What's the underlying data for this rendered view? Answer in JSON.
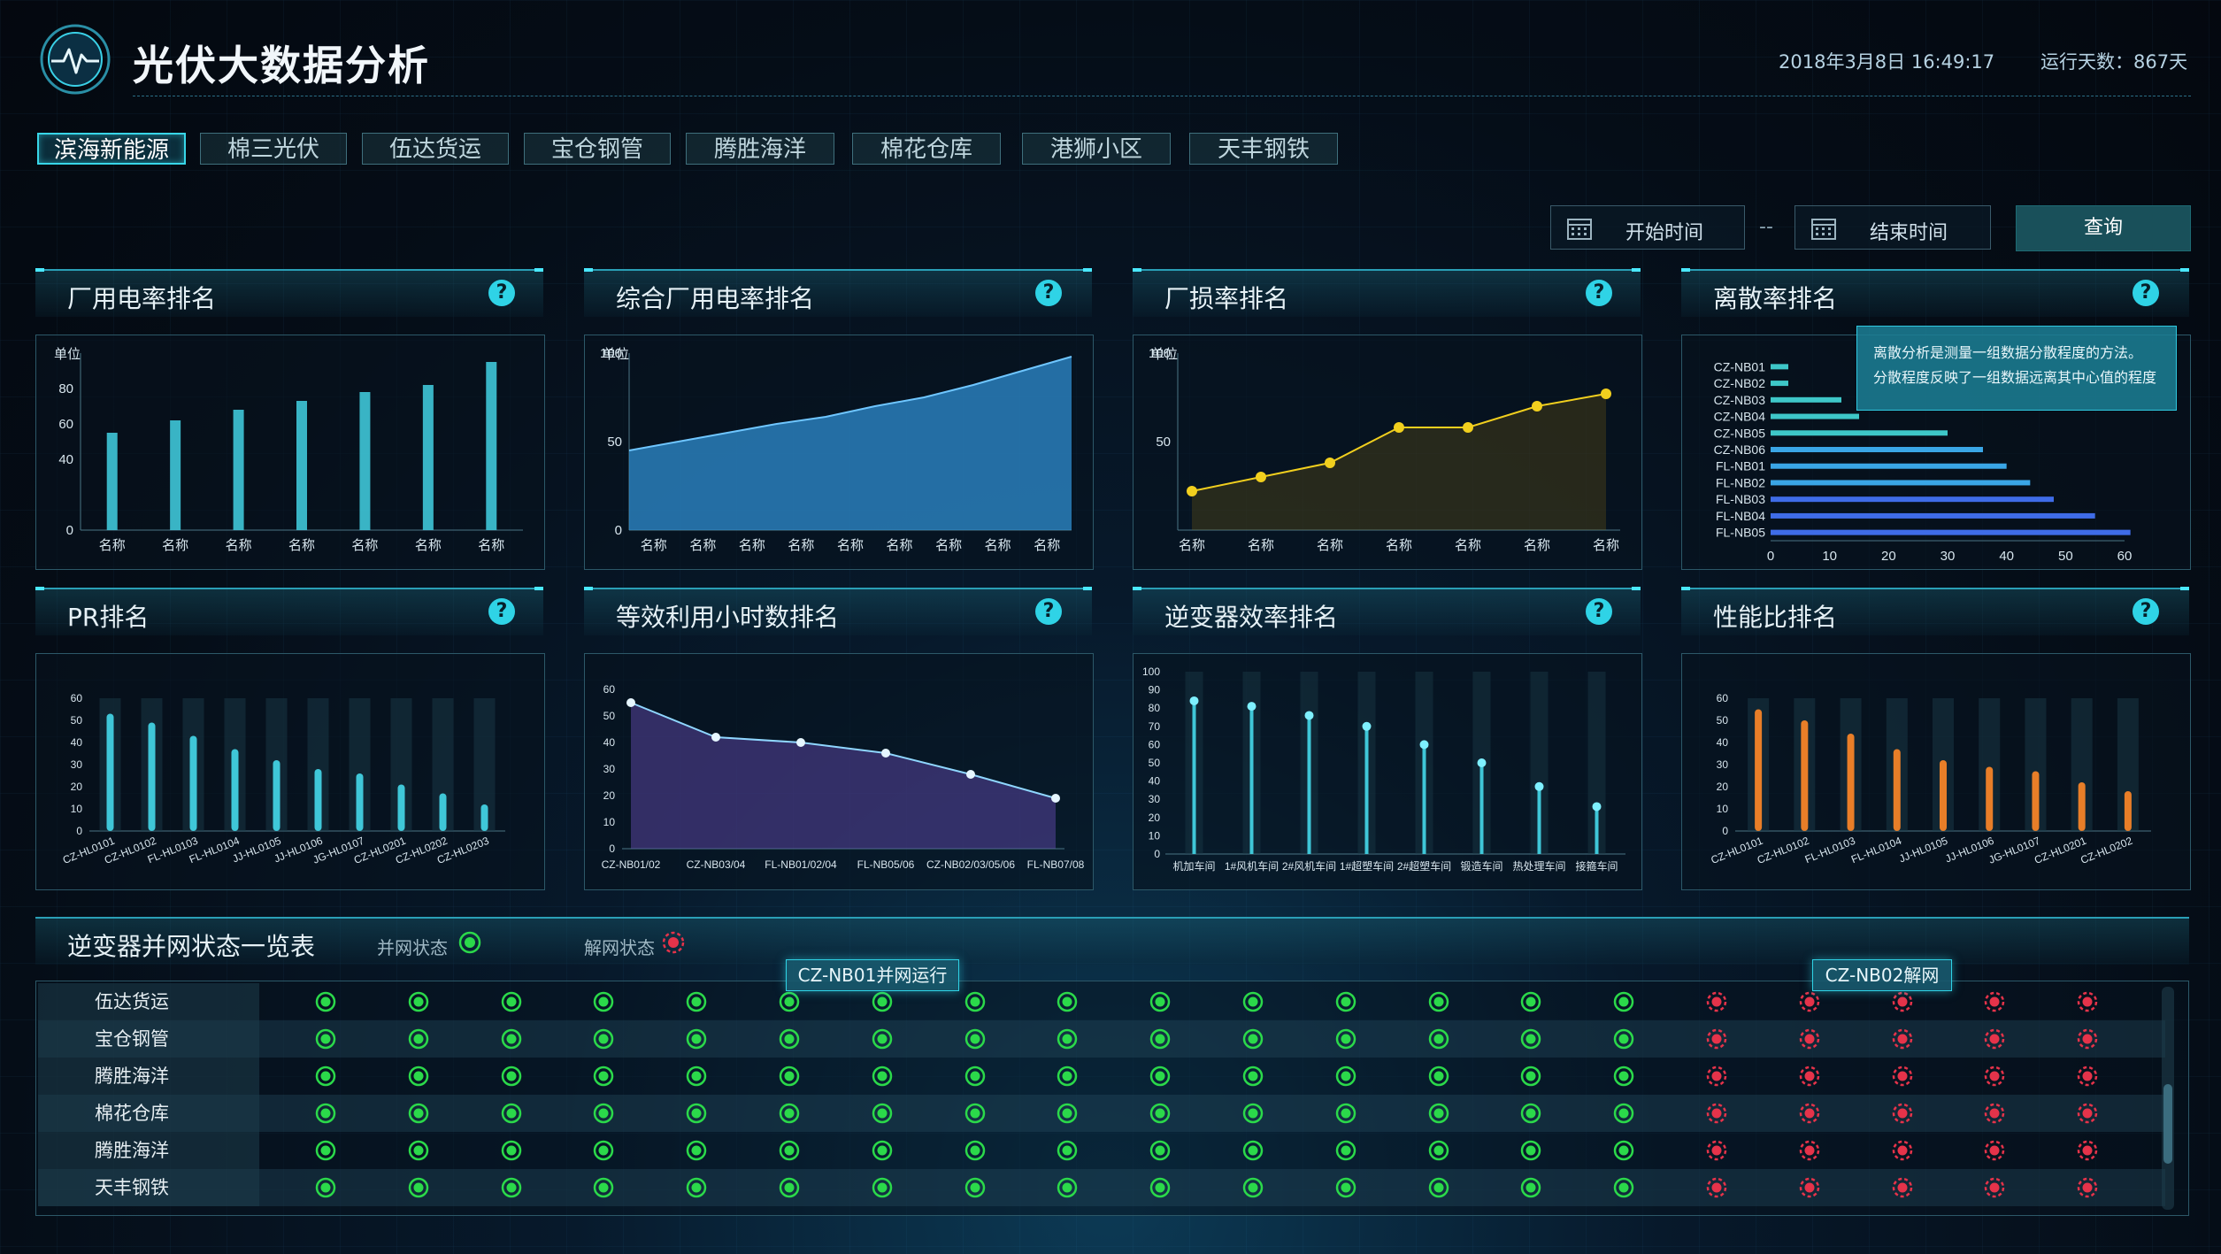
{
  "app": {
    "title": "光伏大数据分析",
    "datetime": "2018年3月8日  16:49:17",
    "run_days": "运行天数：867天"
  },
  "tabs": [
    "滨海新能源",
    "棉三光伏",
    "伍达货运",
    "宝仓钢管",
    "腾胜海洋",
    "棉花仓库",
    "港狮小区",
    "天丰钢铁"
  ],
  "active_tab": 0,
  "query": {
    "start_placeholder": "开始时间",
    "separator": "--",
    "end_placeholder": "结束时间",
    "button": "查询"
  },
  "panels": [
    {
      "title": "厂用电率排名"
    },
    {
      "title": "综合厂用电率排名"
    },
    {
      "title": "厂损率排名"
    },
    {
      "title": "离散率排名"
    },
    {
      "title": "PR排名"
    },
    {
      "title": "等效利用小时数排名"
    },
    {
      "title": "逆变器效率排名"
    },
    {
      "title": "性能比排名"
    }
  ],
  "help_glyph": "?",
  "tooltip": {
    "line1": "离散分析是测量一组数据分散程度的方法。",
    "line2": "分散程度反映了一组数据远离其中心值的程度"
  },
  "chart_data": [
    {
      "type": "bar",
      "ylabel": "单位",
      "categories": [
        "名称",
        "名称",
        "名称",
        "名称",
        "名称",
        "名称",
        "名称"
      ],
      "values": [
        55,
        62,
        68,
        73,
        78,
        82,
        95
      ],
      "ylim": [
        0,
        100
      ],
      "yticks": [
        0,
        40,
        60,
        80
      ]
    },
    {
      "type": "area",
      "ylabel": "单位",
      "categories": [
        "名称",
        "名称",
        "名称",
        "名称",
        "名称",
        "名称",
        "名称",
        "名称",
        "名称"
      ],
      "values": [
        45,
        50,
        55,
        60,
        64,
        70,
        75,
        82,
        90,
        98
      ],
      "ylim": [
        0,
        100
      ],
      "yticks": [
        0,
        50,
        100
      ]
    },
    {
      "type": "line",
      "ylabel": "单位",
      "categories": [
        "名称",
        "名称",
        "名称",
        "名称",
        "名称",
        "名称",
        "名称"
      ],
      "values": [
        22,
        30,
        38,
        58,
        58,
        70,
        77
      ],
      "ylim": [
        0,
        100
      ],
      "yticks": [
        50,
        100
      ]
    },
    {
      "type": "bar",
      "orientation": "horizontal",
      "categories": [
        "CZ-NB01",
        "CZ-NB02",
        "CZ-NB03",
        "CZ-NB04",
        "CZ-NB05",
        "CZ-NB06",
        "FL-NB01",
        "FL-NB02",
        "FL-NB03",
        "FL-NB04",
        "FL-NB05"
      ],
      "values": [
        3,
        3,
        12,
        15,
        30,
        36,
        40,
        44,
        48,
        55,
        61
      ],
      "xlim": [
        0,
        60
      ],
      "xticks": [
        0,
        10,
        20,
        30,
        40,
        50,
        60
      ]
    },
    {
      "type": "bar",
      "categories": [
        "CZ-HL0101",
        "CZ-HL0102",
        "FL-HL0103",
        "FL-HL0104",
        "JJ-HL0105",
        "JJ-HL0106",
        "JG-HL0107",
        "CZ-HL0201",
        "CZ-HL0202",
        "CZ-HL0203"
      ],
      "values": [
        53,
        49,
        43,
        37,
        32,
        28,
        26,
        21,
        17,
        12
      ],
      "ylim": [
        0,
        60
      ],
      "yticks": [
        0,
        10,
        20,
        30,
        40,
        50,
        60
      ]
    },
    {
      "type": "area",
      "categories": [
        "CZ-NB01/02",
        "CZ-NB03/04",
        "FL-NB01/02/04",
        "FL-NB05/06",
        "CZ-NB02/03/05/06",
        "FL-NB07/08"
      ],
      "x_points": [
        0,
        0.2,
        0.4,
        0.6,
        0.8,
        1.0
      ],
      "values": [
        55,
        42,
        40,
        36,
        28,
        19
      ],
      "ylim": [
        0,
        60
      ],
      "yticks": [
        0,
        10,
        20,
        30,
        40,
        50,
        60
      ]
    },
    {
      "type": "bar",
      "categories": [
        "机加车间",
        "1#风机车间",
        "2#风机车间",
        "1#超塑车间",
        "2#超塑车间",
        "锻造车间",
        "热处理车间",
        "接箍车间"
      ],
      "values": [
        84,
        81,
        76,
        70,
        60,
        50,
        37,
        26
      ],
      "ylim": [
        0,
        100
      ],
      "yticks": [
        0,
        10,
        20,
        30,
        40,
        50,
        60,
        70,
        80,
        90,
        100
      ]
    },
    {
      "type": "bar",
      "categories": [
        "CZ-HL0101",
        "CZ-HL0102",
        "FL-HL0103",
        "FL-HL0104",
        "JJ-HL0105",
        "JJ-HL0106",
        "JG-HL0107",
        "CZ-HL0201",
        "CZ-HL0202"
      ],
      "values": [
        55,
        50,
        44,
        37,
        32,
        29,
        27,
        22,
        18
      ],
      "ylim": [
        0,
        60
      ],
      "yticks": [
        0,
        10,
        20,
        30,
        40,
        50,
        60
      ]
    }
  ],
  "status": {
    "title": "逆变器并网状态一览表",
    "legend_on": "并网状态",
    "legend_off": "解网状态",
    "callout_on": "CZ-NB01并网运行",
    "callout_off": "CZ-NB02解网",
    "rows": [
      "伍达货运",
      "宝仓钢管",
      "腾胜海洋",
      "棉花仓库",
      "腾胜海洋",
      "天丰钢铁"
    ],
    "on_count": 15,
    "off_count": 5
  },
  "colors": {
    "accent": "#2fd3e6",
    "on": "#2bd94a",
    "off": "#e5334a",
    "bar_teal": "#3fc7d8",
    "bar_orange": "#e87e28",
    "line_yellow": "#f1cf1e"
  }
}
